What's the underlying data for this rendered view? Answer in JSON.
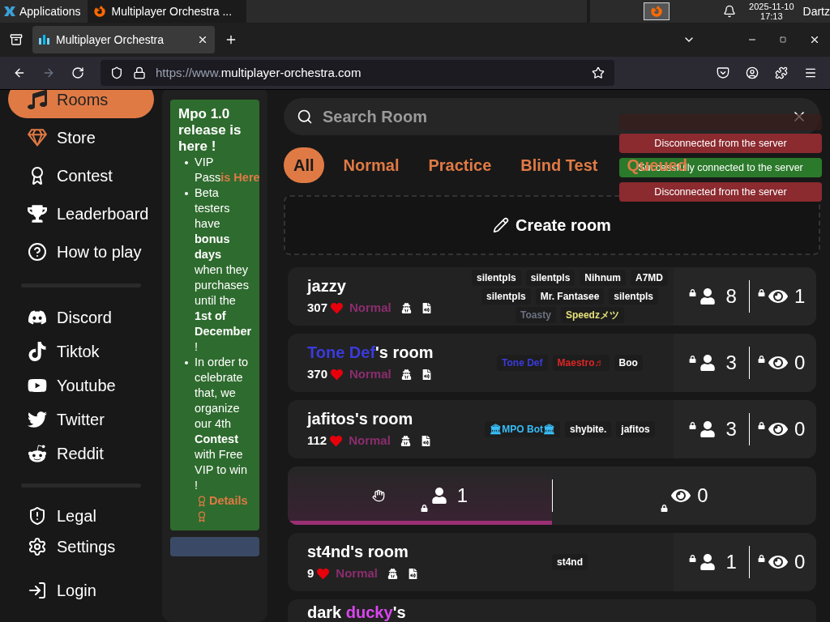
{
  "os_bar": {
    "menu": "Applications",
    "task": "Multiplayer Orchestra ...",
    "date": "2025-11-10",
    "time": "17:13",
    "user": "Dartz"
  },
  "browser": {
    "tab": "Multiplayer Orchestra",
    "url_prefix": "https://www.",
    "url_domain": "multiplayer-orchestra.com"
  },
  "sidebar": {
    "items": [
      {
        "label": "Rooms",
        "selected": true
      },
      {
        "label": "Store",
        "selected": false
      },
      {
        "label": "Contest",
        "selected": false
      },
      {
        "label": "Leaderboard",
        "selected": false
      },
      {
        "label": "How to play",
        "selected": false
      }
    ],
    "social": [
      "Discord",
      "Tiktok",
      "Youtube",
      "Twitter",
      "Reddit"
    ],
    "bottom": [
      "Legal",
      "Settings",
      "Login"
    ]
  },
  "notice": {
    "title": "Mpo 1.0 release is here !",
    "bullets": [
      [
        {
          "kind": "text",
          "text": "VIP Pass"
        },
        {
          "kind": "link",
          "text": "is Here"
        }
      ],
      [
        {
          "kind": "text",
          "text": "Beta testers have **bonus days** when they purchases until the **1st of December** !"
        }
      ],
      [
        {
          "kind": "text",
          "text": "In order to celebrate that, we organize our 4th **Contest** with Free VIP to win !"
        },
        {
          "kind": "award"
        },
        {
          "kind": "link",
          "text": "Details"
        },
        {
          "kind": "award"
        }
      ]
    ]
  },
  "search": {
    "placeholder": "Search Room"
  },
  "filters": [
    {
      "label": "All",
      "selected": true
    },
    {
      "label": "Normal",
      "selected": false
    },
    {
      "label": "Practice",
      "selected": false
    },
    {
      "label": "Blind Test",
      "selected": false
    },
    {
      "label": "Queued",
      "selected": false
    }
  ],
  "create_room": "Create room",
  "toasts": [
    {
      "kind": "error",
      "text": "Disconnected from the server"
    },
    {
      "kind": "success",
      "text": "Successfully connected to the server"
    },
    {
      "kind": "error",
      "text": "Disconnected from the server"
    }
  ],
  "rooms": [
    {
      "kind": "full",
      "title": [
        {
          "text": "jazzy",
          "color": "#ffffff"
        }
      ],
      "score": "307",
      "mode": "Normal",
      "players": [
        {
          "text": "silentpls",
          "color": "#ffffff"
        },
        {
          "text": "silentpls",
          "color": "#ffffff"
        },
        {
          "text": "Nihnum",
          "color": "#ffffff"
        },
        {
          "text": "A7MD",
          "color": "#ffffff"
        },
        {
          "text": "silentpls",
          "color": "#ffffff"
        },
        {
          "text": "Mr. Fantasee",
          "color": "#ffffff"
        },
        {
          "text": "silentpls",
          "color": "#ffffff"
        },
        {
          "text": "Toasty",
          "color": "#6b7280"
        },
        {
          "text": "Speedzメツ",
          "color": "#e5e07a"
        }
      ],
      "player_count": "8",
      "spectators": "1"
    },
    {
      "kind": "full",
      "title": [
        {
          "text": "Tone Def",
          "color": "#3b3bdc"
        },
        {
          "text": "'s room",
          "color": "#ffffff"
        }
      ],
      "score": "370",
      "mode": "Normal",
      "players": [
        {
          "text": "Tone Def",
          "color": "#3b3bdc"
        },
        {
          "text": "Maestro♬",
          "color": "#dc2626"
        },
        {
          "text": "Boo",
          "color": "#ffffff"
        }
      ],
      "player_count": "3",
      "spectators": "0"
    },
    {
      "kind": "full",
      "title": [
        {
          "text": "jafitos's room",
          "color": "#ffffff"
        }
      ],
      "score": "112",
      "mode": "Normal",
      "players": [
        {
          "text": "🏛MPO Bot🏛",
          "color": "#38bdf8"
        },
        {
          "text": "shybite.",
          "color": "#ffffff"
        },
        {
          "text": "jafitos",
          "color": "#ffffff"
        }
      ],
      "player_count": "3",
      "spectators": "0"
    },
    {
      "kind": "empty",
      "player_count": "1",
      "spectators": "0",
      "level": 0.5
    },
    {
      "kind": "full",
      "title": [
        {
          "text": "st4nd's room",
          "color": "#ffffff"
        }
      ],
      "score": "9",
      "mode": "Normal",
      "players": [
        {
          "text": "st4nd",
          "color": "#ffffff"
        }
      ],
      "player_count": "1",
      "spectators": "0"
    },
    {
      "kind": "partial",
      "title": [
        {
          "text": "dark ",
          "color": "#ffffff"
        },
        {
          "text": "ducky",
          "color": "#d946ef"
        },
        {
          "text": "'s",
          "color": "#ffffff"
        }
      ]
    }
  ]
}
